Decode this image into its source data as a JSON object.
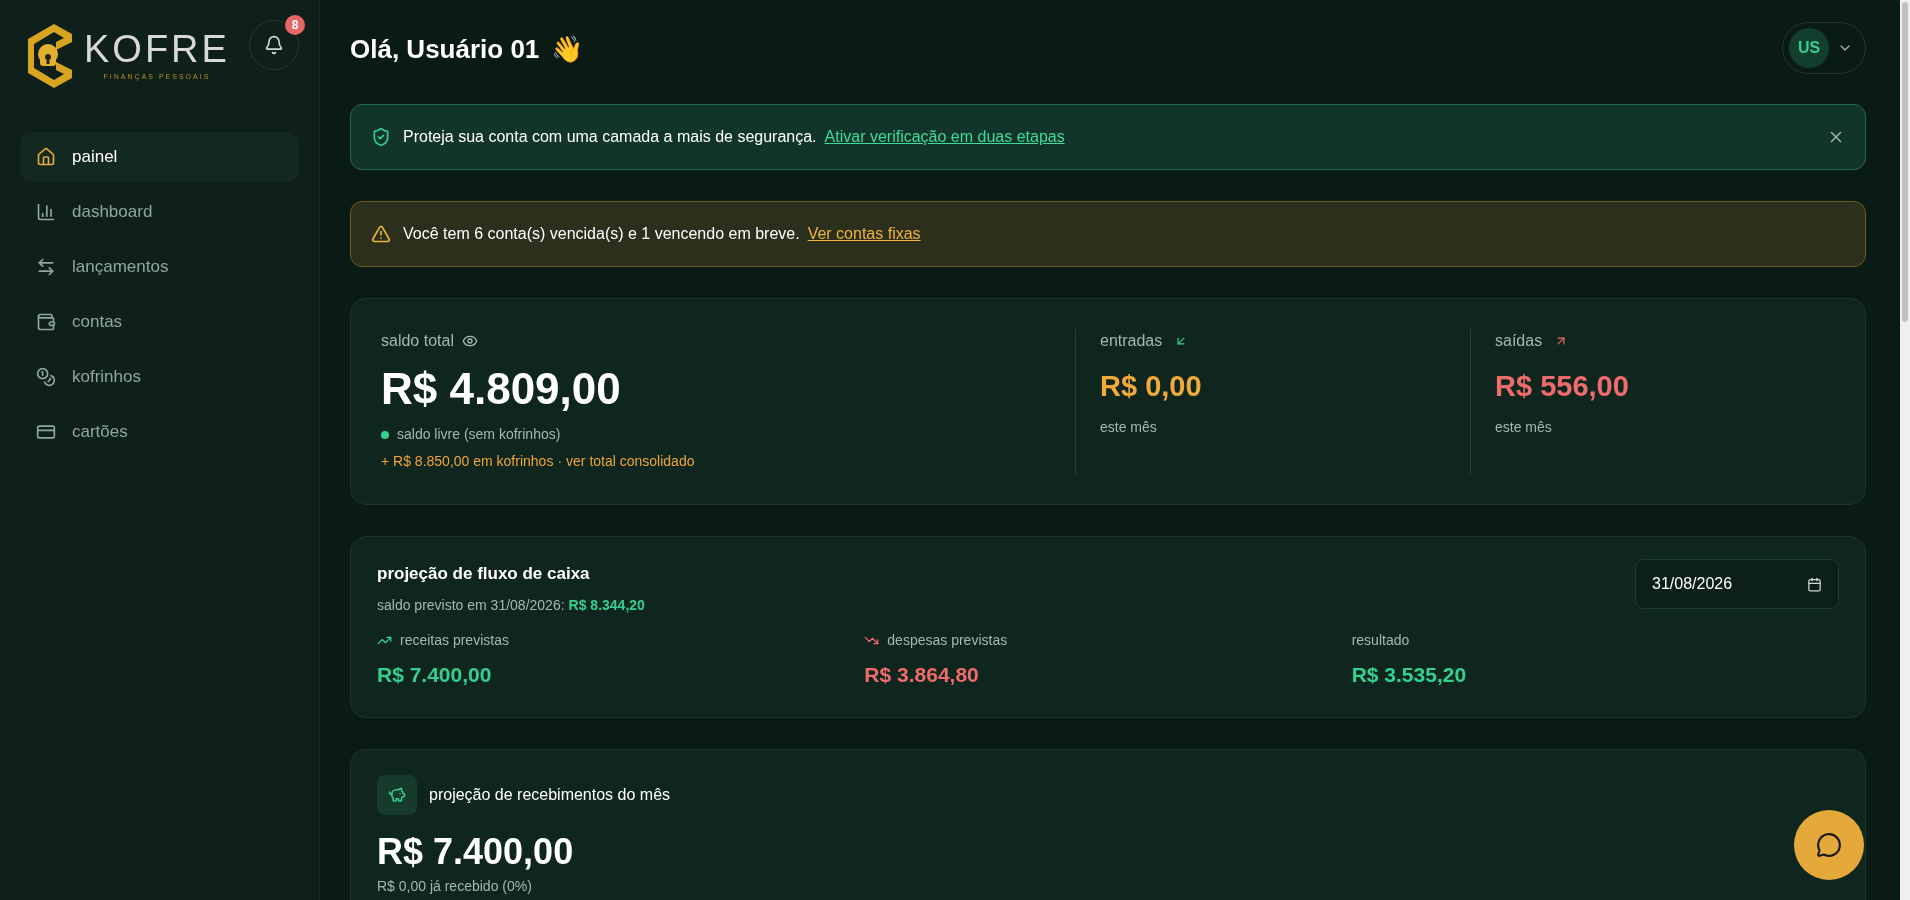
{
  "brand": {
    "name": "KOFRE",
    "tagline": "FINANÇAS PESSOAIS"
  },
  "notifications": {
    "count": "8"
  },
  "sidebar": {
    "items": [
      {
        "label": "painel",
        "selected": true
      },
      {
        "label": "dashboard",
        "selected": false
      },
      {
        "label": "lançamentos",
        "selected": false
      },
      {
        "label": "contas",
        "selected": false
      },
      {
        "label": "kofrinhos",
        "selected": false
      },
      {
        "label": "cartões",
        "selected": false
      }
    ]
  },
  "header": {
    "greeting": "Olá, Usuário 01",
    "emoji": "👋",
    "avatar": "US"
  },
  "alerts": [
    {
      "kind": "security",
      "text": "Proteja sua conta com uma camada a mais de segurança.",
      "link": "Ativar verificação em duas etapas",
      "closable": true
    },
    {
      "kind": "warning",
      "text": "Você tem 6 conta(s) vencida(s) e 1 vencendo em breve.",
      "link": "Ver contas fixas",
      "closable": false
    }
  ],
  "balance": {
    "label": "saldo total",
    "value": "R$ 4.809,00",
    "note": "saldo livre (sem kofrinhos)",
    "extra": "+ R$ 8.850,00 em kofrinhos",
    "separator": "·",
    "extra_link": "ver total consolidado",
    "stats": [
      {
        "label": "entradas",
        "kind": "income",
        "value": "R$ 0,00",
        "sub": "este mês"
      },
      {
        "label": "saídas",
        "kind": "expense",
        "value": "R$ 556,00",
        "sub": "este mês"
      }
    ]
  },
  "cashflow": {
    "title": "projeção de fluxo de caixa",
    "subtitle": "saldo previsto em 31/08/2026:",
    "subtitle_value": "R$ 8.344,20",
    "date": "31/08/2026",
    "items": [
      {
        "label": "receitas previstas",
        "kind": "rise",
        "value": "R$ 7.400,00"
      },
      {
        "label": "despesas previstas",
        "kind": "fall",
        "value": "R$ 3.864,80"
      },
      {
        "label": "resultado",
        "kind": "net",
        "value": "R$ 3.535,20"
      }
    ]
  },
  "receipts": {
    "title": "projeção de recebimentos do mês",
    "value": "R$ 7.400,00",
    "note": "R$ 0,00 já recebido (0%)"
  }
}
